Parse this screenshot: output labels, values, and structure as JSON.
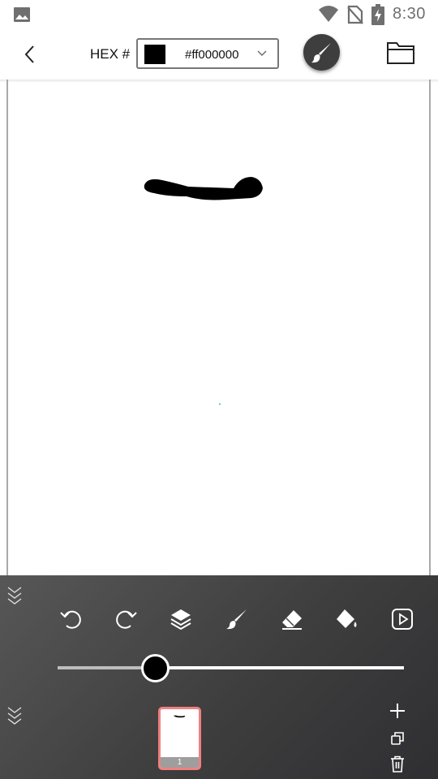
{
  "status_bar": {
    "time": "8:30",
    "icons": [
      "gallery-icon",
      "wifi-icon",
      "no-sim-icon",
      "battery-charging-icon"
    ]
  },
  "toolbar": {
    "back_icon": "chevron-left-icon",
    "hex_label": "HEX #",
    "color_value": "#ff000000",
    "swatch_color": "#000000",
    "brush_icon": "brush-icon",
    "folder_icon": "folder-icon"
  },
  "canvas": {
    "background": "#ffffff",
    "stroke_color": "#000000"
  },
  "bottom_panel": {
    "tools": [
      "undo-icon",
      "redo-icon",
      "layers-icon",
      "brush-icon",
      "eraser-icon",
      "fill-bucket-icon",
      "play-icon"
    ],
    "brush_size_fraction": 0.28,
    "frames": [
      {
        "number": "1",
        "selected": true
      }
    ],
    "frame_actions": [
      "add-icon",
      "duplicate-icon",
      "delete-icon"
    ]
  }
}
